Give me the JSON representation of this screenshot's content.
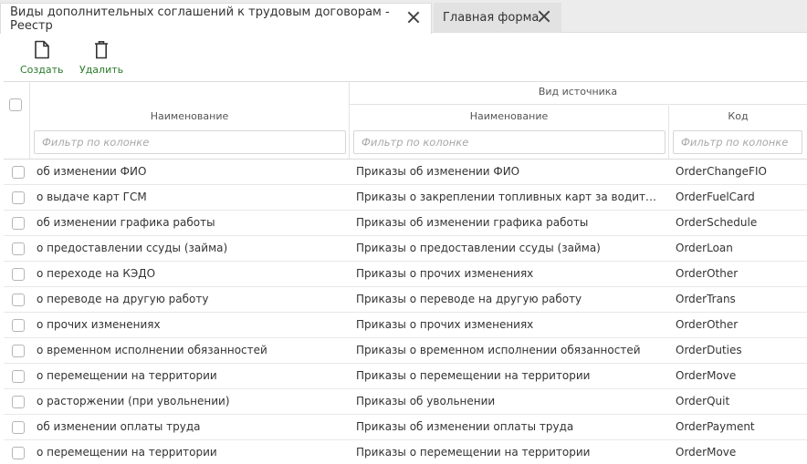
{
  "tabs": [
    {
      "label": "Виды дополнительных соглашений к трудовым договорам - Реестр",
      "active": true
    },
    {
      "label": "Главная форма",
      "active": false
    }
  ],
  "toolbar": {
    "create_label": "Создать",
    "delete_label": "Удалить"
  },
  "table": {
    "group_header": "Вид источника",
    "columns": [
      "Наименование",
      "Наименование",
      "Код"
    ],
    "filter_placeholder": "Фильтр по колонке",
    "rows": [
      {
        "name": "об изменении ФИО",
        "source_name": "Приказы об изменении ФИО",
        "code": "OrderChangeFIO"
      },
      {
        "name": "о выдаче карт ГСМ",
        "source_name": "Приказы о закреплении топливных карт за водителями",
        "code": "OrderFuelCard"
      },
      {
        "name": "об изменении графика работы",
        "source_name": "Приказы об изменении графика работы",
        "code": "OrderSchedule"
      },
      {
        "name": "о предоставлении ссуды (займа)",
        "source_name": "Приказы о предоставлении ссуды (займа)",
        "code": "OrderLoan"
      },
      {
        "name": "о переходе на КЭДО",
        "source_name": "Приказы о прочих изменениях",
        "code": "OrderOther"
      },
      {
        "name": "о переводе на другую работу",
        "source_name": "Приказы о переводе на другую работу",
        "code": "OrderTrans"
      },
      {
        "name": "о прочих изменениях",
        "source_name": "Приказы о прочих изменениях",
        "code": "OrderOther"
      },
      {
        "name": "о временном исполнении обязанностей",
        "source_name": "Приказы о временном исполнении обязанностей",
        "code": "OrderDuties"
      },
      {
        "name": "о перемещении на территории",
        "source_name": "Приказы о перемещении на территории",
        "code": "OrderMove"
      },
      {
        "name": "о расторжении (при увольнении)",
        "source_name": "Приказы об увольнении",
        "code": "OrderQuit"
      },
      {
        "name": "об изменении оплаты труда",
        "source_name": "Приказы об изменении оплаты труда",
        "code": "OrderPayment"
      },
      {
        "name": "о перемещении на территории",
        "source_name": "Приказы о перемещении на территории",
        "code": "OrderMove"
      }
    ]
  },
  "icons": {
    "create": "document-icon",
    "delete": "trash-icon",
    "close": "close-icon"
  },
  "colors": {
    "accent": "#2a7a2a",
    "tabbar_bg": "#ececec"
  }
}
